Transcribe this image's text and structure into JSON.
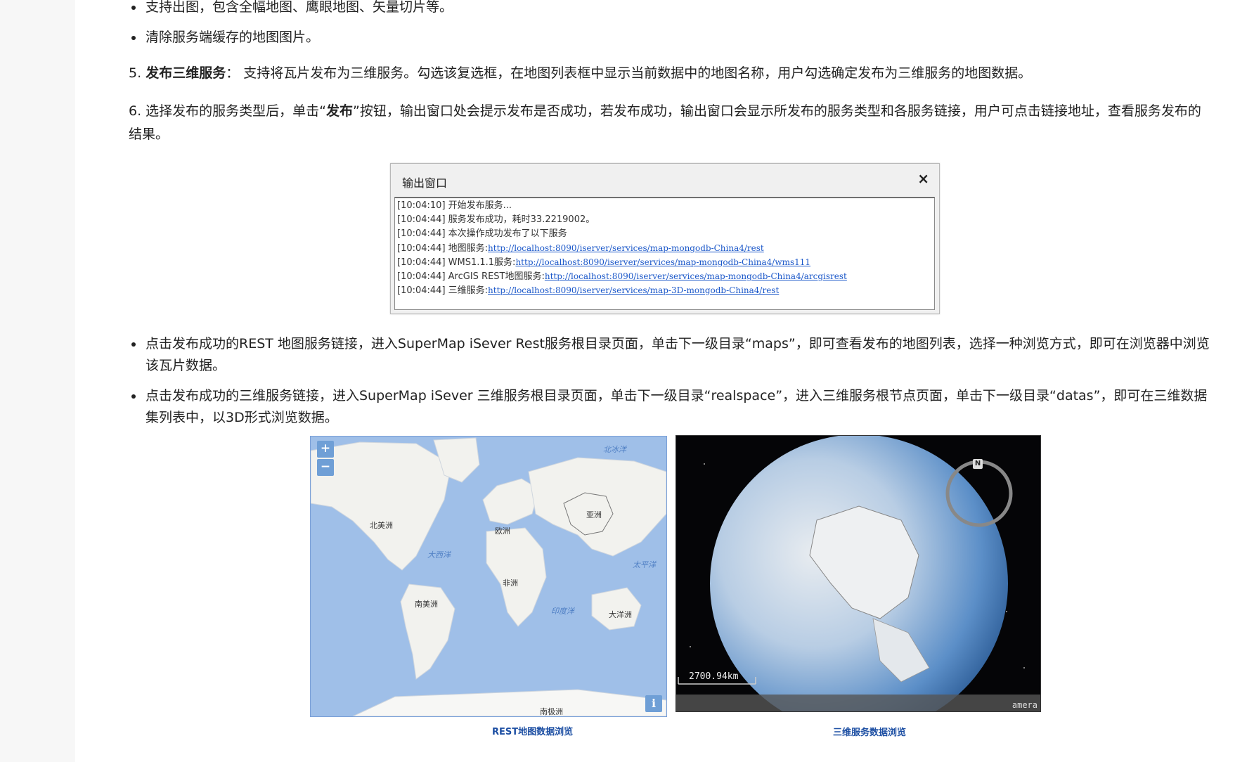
{
  "bullets_top": [
    "支持出图，包含全幅地图、鹰眼地图、矢量切片等。",
    "清除服务端缓存的地图图片。"
  ],
  "step5": {
    "num": "5.",
    "bold": "发布三维服务",
    "text": "： 支持将瓦片发布为三维服务。勾选该复选框，在地图列表框中显示当前数据中的地图名称，用户勾选确定发布为三维服务的地图数据。"
  },
  "step6": {
    "prefix": "6. 选择发布的服务类型后，单击“",
    "bold": "发布",
    "suffix": "”按钮，输出窗口处会提示发布是否成功，若发布成功，输出窗口会显示所发布的服务类型和各服务链接，用户可点击链接地址，查看服务发布的结果。"
  },
  "output_window": {
    "title": "输出窗口",
    "close": "×",
    "lines": [
      {
        "text": "[10:04:10] 开始发布服务...",
        "link": ""
      },
      {
        "text": "[10:04:44] 服务发布成功，耗时33.2219002。",
        "link": ""
      },
      {
        "text": "[10:04:44] 本次操作成功发布了以下服务",
        "link": ""
      },
      {
        "text": "[10:04:44] 地图服务:",
        "link": "http://localhost:8090/iserver/services/map-mongodb-China4/rest"
      },
      {
        "text": "[10:04:44] WMS1.1.1服务:",
        "link": "http://localhost:8090/iserver/services/map-mongodb-China4/wms111"
      },
      {
        "text": "[10:04:44] ArcGIS REST地图服务:",
        "link": "http://localhost:8090/iserver/services/map-mongodb-China4/arcgisrest"
      },
      {
        "text": "[10:04:44] 三维服务:",
        "link": "http://localhost:8090/iserver/services/map-3D-mongodb-China4/rest"
      }
    ]
  },
  "bullets_bottom": [
    "点击发布成功的REST 地图服务链接，进入SuperMap iSever Rest服务根目录页面，单击下一级目录“maps”，即可查看发布的地图列表，选择一种浏览方式，即可在浏览器中浏览该瓦片数据。",
    "点击发布成功的三维服务链接，进入SuperMap iSever 三维服务根目录页面，单击下一级目录“realspace”，进入三维服务根节点页面，单击下一级目录“datas”，即可在三维数据集列表中，以3D形式浏览数据。"
  ],
  "map2d": {
    "zoom_in": "+",
    "zoom_out": "−",
    "info": "i",
    "labels": [
      "北美洲",
      "欧洲",
      "亚洲",
      "非洲",
      "南美洲",
      "大洋洲",
      "南极洲"
    ],
    "sea_labels": [
      "北冰洋",
      "大西洋",
      "太平洋",
      "印度洋"
    ],
    "caption": "REST地图数据浏览"
  },
  "map3d": {
    "scale": "2700.94km",
    "compass": "N",
    "watermark": "amera",
    "caption": "三维服务数据浏览"
  },
  "colors": {
    "ocean": "#9fbfe8",
    "land": "#f2f2ee",
    "link": "#1a57c9",
    "caption": "#1d4fa3"
  }
}
